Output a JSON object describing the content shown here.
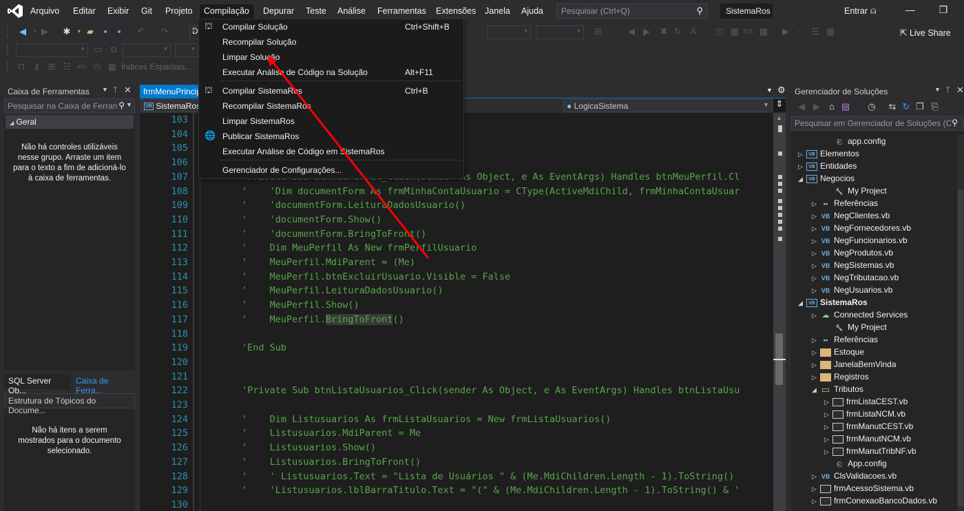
{
  "menubar": {
    "items": [
      "Arquivo",
      "Editar",
      "Exibir",
      "Git",
      "Projeto",
      "Compilação",
      "Depurar",
      "Teste",
      "Análise",
      "Ferramentas",
      "Extensões",
      "Janela",
      "Ajuda"
    ],
    "active_item": "Compilação",
    "search_placeholder": "Pesquisar (Ctrl+Q)",
    "solution_name": "SistemaRos",
    "sign_in": "Entrar"
  },
  "toolbar": {
    "spatial_indexes_label": "Índices Espaciais...",
    "live_share_label": "Live Share",
    "config_combo_partial": "D"
  },
  "compile_menu": {
    "items": [
      {
        "label": "Compilar Solução",
        "shortcut": "Ctrl+Shift+B",
        "icon": "build-icon"
      },
      {
        "label": "Recompilar Solução",
        "shortcut": "",
        "icon": ""
      },
      {
        "label": "Limpar Solução",
        "shortcut": "",
        "icon": ""
      },
      {
        "label": "Executar Análise de Código na Solução",
        "shortcut": "Alt+F11",
        "icon": ""
      },
      {
        "label": "Compilar SistemaRos",
        "shortcut": "Ctrl+B",
        "icon": "build-icon"
      },
      {
        "label": "Recompilar SistemaRos",
        "shortcut": "",
        "icon": ""
      },
      {
        "label": "Limpar SistemaRos",
        "shortcut": "",
        "icon": ""
      },
      {
        "label": "Publicar SistemaRos",
        "shortcut": "",
        "icon": "publish-icon"
      },
      {
        "label": "Executar Análise de Código em SistemaRos",
        "shortcut": "",
        "icon": ""
      },
      {
        "label": "Gerenciador de Configurações...",
        "shortcut": "",
        "icon": ""
      }
    ]
  },
  "toolbox": {
    "title": "Caixa de Ferramentas",
    "search_placeholder": "Pesquisar na Caixa de Ferran",
    "group": "Geral",
    "empty_message": "Não há controles utilizáveis nesse grupo. Arraste um item para o texto a fim de adicioná-lo à caixa de ferramentas."
  },
  "bottom_tabs": [
    "SQL Server Ob...",
    "Caixa de Ferra..."
  ],
  "outline": {
    "title": "Estrutura de Tópicos do Docume...",
    "empty_message": "Não há itens a serem mostrados para o documento selecionado."
  },
  "editor": {
    "tab_label": "frmMenuPrincipal.vb",
    "project_combo": "SistemaRos",
    "member_combo": "LogicaSistema",
    "lines": [
      {
        "n": "103",
        "text": ""
      },
      {
        "n": "104",
        "text": ""
      },
      {
        "n": "105",
        "text": ""
      },
      {
        "n": "106",
        "text": ""
      },
      {
        "n": "107",
        "text": "'Private Sub btnMeuPerfil_Click(sender As Object, e As EventArgs) Handles btnMeuPerfil.Cl"
      },
      {
        "n": "108",
        "text": "'    'Dim documentForm As frmMinhaContaUsuario = CType(ActiveMdiChild, frmMinhaContaUsuar"
      },
      {
        "n": "109",
        "text": "'    'documentForm.LeituraDadosUsuario()"
      },
      {
        "n": "110",
        "text": "'    'documentForm.Show()"
      },
      {
        "n": "111",
        "text": "'    'documentForm.BringToFront()"
      },
      {
        "n": "112",
        "text": "'    Dim MeuPerfil As New frmPerfilUsuario"
      },
      {
        "n": "113",
        "text": "'    MeuPerfil.MdiParent = (Me)"
      },
      {
        "n": "114",
        "text": "'    MeuPerfil.btnExcluirUsuario.Visible = False"
      },
      {
        "n": "115",
        "text": "'    MeuPerfil.LeituraDadosUsuario()"
      },
      {
        "n": "116",
        "text": "'    MeuPerfil.Show()"
      },
      {
        "n": "117",
        "text": "'    MeuPerfil.BringToFront()"
      },
      {
        "n": "118",
        "text": ""
      },
      {
        "n": "119",
        "text": "'End Sub"
      },
      {
        "n": "120",
        "text": ""
      },
      {
        "n": "121",
        "text": ""
      },
      {
        "n": "122",
        "text": "'Private Sub btnListaUsuarios_Click(sender As Object, e As EventArgs) Handles btnListaUsu"
      },
      {
        "n": "123",
        "text": ""
      },
      {
        "n": "124",
        "text": "'    Dim Listusuarios As frmListaUsuarios = New frmListaUsuarios()"
      },
      {
        "n": "125",
        "text": "'    Listusuarios.MdiParent = Me"
      },
      {
        "n": "126",
        "text": "'    Listusuarios.Show()"
      },
      {
        "n": "127",
        "text": "'    Listusuarios.BringToFront()"
      },
      {
        "n": "128",
        "text": "'    ' Listusuarios.Text = \"Lista de Usuários \" & (Me.MdiChildren.Length - 1).ToString()"
      },
      {
        "n": "129",
        "text": "'    'Listusuarios.lblBarraTitulo.Text = \"(\" & (Me.MdiChildren.Length - 1).ToString() & '"
      },
      {
        "n": "130",
        "text": ""
      }
    ]
  },
  "solution_explorer": {
    "title": "Gerenciador de Soluções",
    "search_placeholder": "Pesquisar em Gerenciador de Soluções (C",
    "nodes": [
      {
        "label": "app.config",
        "icon": "config-icon",
        "arrow": ""
      },
      {
        "label": "Elementos",
        "icon": "vb-project-icon",
        "arrow": "collapsed"
      },
      {
        "label": "Entidades",
        "icon": "vb-project-icon",
        "arrow": "collapsed"
      },
      {
        "label": "Negocios",
        "icon": "vb-project-icon",
        "arrow": "expanded"
      },
      {
        "label": "My Project",
        "icon": "wrench-icon",
        "arrow": ""
      },
      {
        "label": "Referências",
        "icon": "references-icon",
        "arrow": "collapsed"
      },
      {
        "label": "NegClientes.vb",
        "icon": "vb-file-icon",
        "arrow": "collapsed"
      },
      {
        "label": "NegFornecedores.vb",
        "icon": "vb-file-icon",
        "arrow": "collapsed"
      },
      {
        "label": "NegFuncionarios.vb",
        "icon": "vb-file-icon",
        "arrow": "collapsed"
      },
      {
        "label": "NegProdutos.vb",
        "icon": "vb-file-icon",
        "arrow": "collapsed"
      },
      {
        "label": "NegSistemas.vb",
        "icon": "vb-file-icon",
        "arrow": "collapsed"
      },
      {
        "label": "NegTributacao.vb",
        "icon": "vb-file-icon",
        "arrow": "collapsed"
      },
      {
        "label": "NegUsuarios.vb",
        "icon": "vb-file-icon",
        "arrow": "collapsed"
      },
      {
        "label": "SistemaRos",
        "icon": "vb-project-icon",
        "arrow": "expanded",
        "bold": true
      },
      {
        "label": "Connected Services",
        "icon": "cloud-icon",
        "arrow": "collapsed"
      },
      {
        "label": "My Project",
        "icon": "wrench-icon",
        "arrow": ""
      },
      {
        "label": "Referências",
        "icon": "references-icon",
        "arrow": "collapsed"
      },
      {
        "label": "Estoque",
        "icon": "folder-icon",
        "arrow": "collapsed"
      },
      {
        "label": "JanelaBemVinda",
        "icon": "folder-icon",
        "arrow": "collapsed"
      },
      {
        "label": "Registros",
        "icon": "folder-icon",
        "arrow": "collapsed"
      },
      {
        "label": "Tributos",
        "icon": "folder-open-icon",
        "arrow": "expanded"
      },
      {
        "label": "frmListaCEST.vb",
        "icon": "form-icon",
        "arrow": "collapsed"
      },
      {
        "label": "frmListaNCM.vb",
        "icon": "form-icon",
        "arrow": "collapsed"
      },
      {
        "label": "frmManutCEST.vb",
        "icon": "form-icon",
        "arrow": "collapsed"
      },
      {
        "label": "frmManutNCM.vb",
        "icon": "form-icon",
        "arrow": "collapsed"
      },
      {
        "label": "frmManutTribNF.vb",
        "icon": "form-icon",
        "arrow": "collapsed"
      },
      {
        "label": "App.config",
        "icon": "config-icon",
        "arrow": ""
      },
      {
        "label": "ClsValidacoes.vb",
        "icon": "vb-file-icon",
        "arrow": "collapsed"
      },
      {
        "label": "frmAcessoSistema.vb",
        "icon": "form-icon",
        "arrow": "collapsed"
      },
      {
        "label": "frmConexaoBancoDados.vb",
        "icon": "form-icon",
        "arrow": "collapsed"
      }
    ]
  },
  "colors": {
    "accent": "#007acc",
    "comment_green": "#57a64a",
    "line_number": "#2b91af",
    "annotation_arrow": "#ff0000"
  }
}
